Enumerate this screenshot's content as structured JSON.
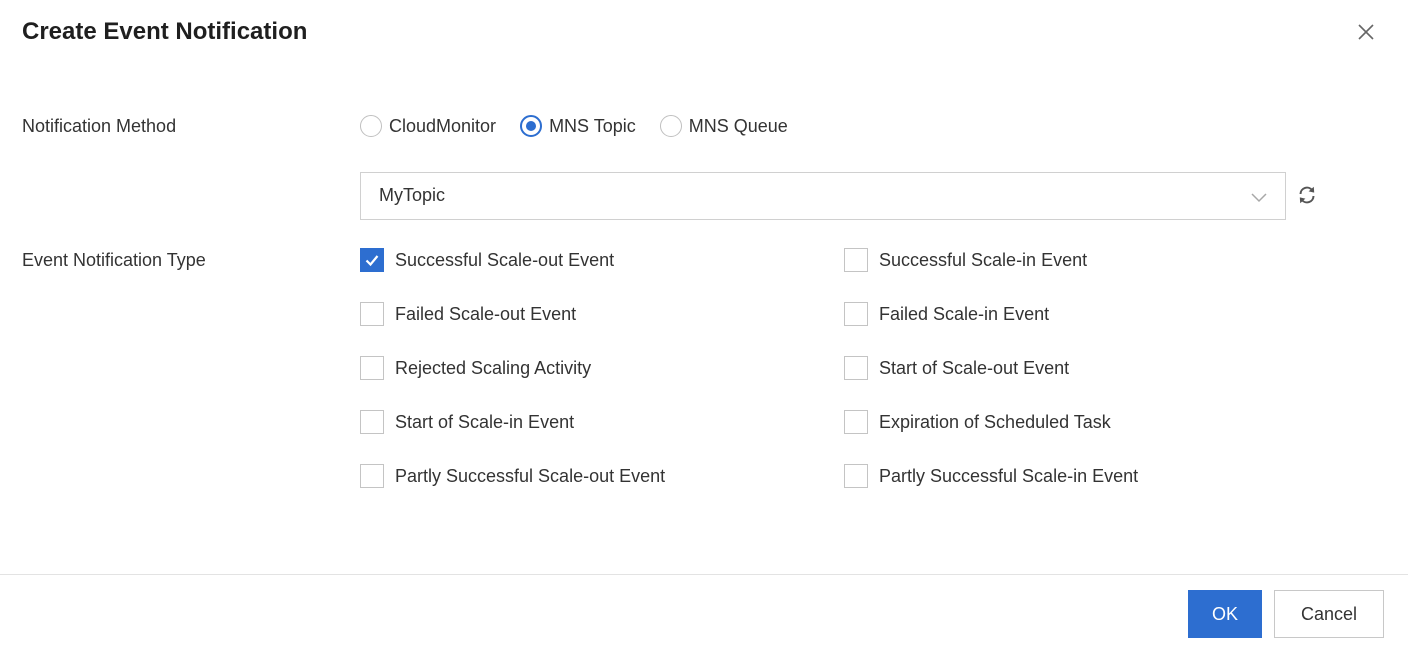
{
  "dialog": {
    "title": "Create Event Notification"
  },
  "notification_method": {
    "label": "Notification Method",
    "options": [
      {
        "label": "CloudMonitor",
        "selected": false
      },
      {
        "label": "MNS Topic",
        "selected": true
      },
      {
        "label": "MNS Queue",
        "selected": false
      }
    ],
    "topic_select": {
      "value": "MyTopic"
    }
  },
  "event_type": {
    "label": "Event Notification Type",
    "items": [
      {
        "label": "Successful Scale-out Event",
        "checked": true
      },
      {
        "label": "Successful Scale-in Event",
        "checked": false
      },
      {
        "label": "Failed Scale-out Event",
        "checked": false
      },
      {
        "label": "Failed Scale-in Event",
        "checked": false
      },
      {
        "label": "Rejected Scaling Activity",
        "checked": false
      },
      {
        "label": "Start of Scale-out Event",
        "checked": false
      },
      {
        "label": "Start of Scale-in Event",
        "checked": false
      },
      {
        "label": "Expiration of Scheduled Task",
        "checked": false
      },
      {
        "label": "Partly Successful Scale-out Event",
        "checked": false
      },
      {
        "label": "Partly Successful Scale-in Event",
        "checked": false
      }
    ]
  },
  "footer": {
    "ok_label": "OK",
    "cancel_label": "Cancel"
  },
  "colors": {
    "accent": "#2d6ed0",
    "text": "#333333",
    "border": "#c4c4c4"
  },
  "icons": {
    "close": "close-icon",
    "dropdown": "chevron-down-icon",
    "refresh": "refresh-icon",
    "check": "checkmark-icon"
  }
}
